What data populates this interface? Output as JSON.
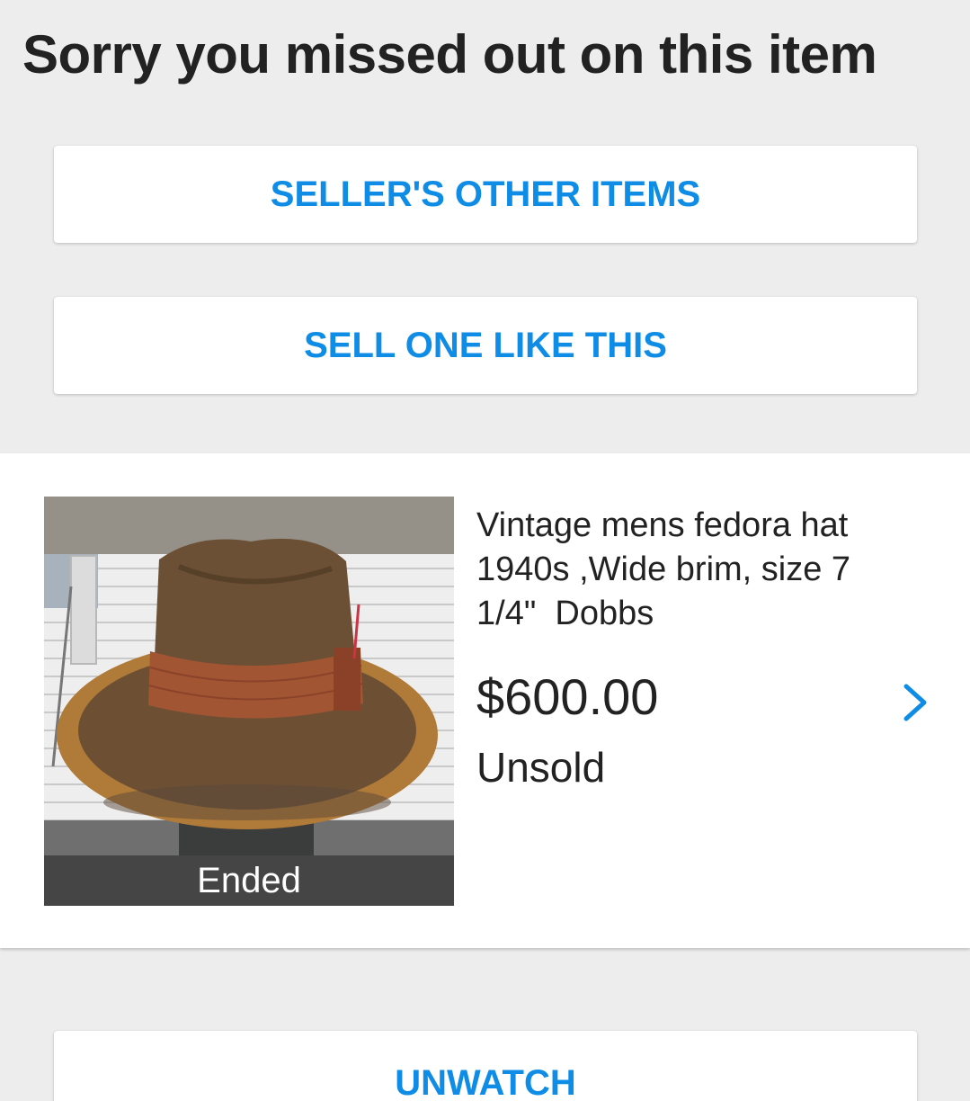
{
  "header": {
    "title": "Sorry you missed out on this item"
  },
  "actions": {
    "seller_items_label": "SELLER'S OTHER ITEMS",
    "sell_one_label": "SELL ONE LIKE THIS",
    "unwatch_label": "UNWATCH"
  },
  "item": {
    "title": "Vintage mens fedora hat 1940s ,Wide brim, size 7 1/4\"  Dobbs",
    "price": "$600.00",
    "status": "Unsold",
    "badge": "Ended",
    "image_icon": "fedora-hat-photo",
    "chevron_icon": "chevron-right-icon"
  },
  "colors": {
    "accent": "#0f8de6",
    "background": "#ededed",
    "text": "#222222",
    "ended_bar": "#454545"
  }
}
